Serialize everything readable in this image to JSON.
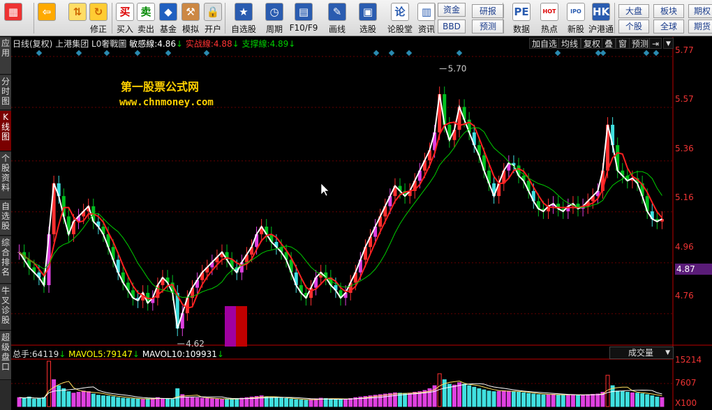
{
  "toolbar": {
    "buttons": [
      {
        "label": "",
        "icon": "grid-icon",
        "glyph": "▦"
      },
      {
        "label": "",
        "icon": "back-arrow-icon",
        "glyph": "⇦"
      },
      {
        "label": "",
        "icon": "up-down-arrow-icon",
        "glyph": "⇅"
      },
      {
        "label": "修正",
        "icon": "refresh-icon",
        "glyph": "↻"
      },
      {
        "label": "买入",
        "icon": "buy-icon",
        "glyph": "买"
      },
      {
        "label": "卖出",
        "icon": "sell-icon",
        "glyph": "卖"
      },
      {
        "label": "基金",
        "icon": "fund-icon",
        "glyph": "◆"
      },
      {
        "label": "模拟",
        "icon": "hammer-icon",
        "glyph": "⚒"
      },
      {
        "label": "开户",
        "icon": "lock-icon",
        "glyph": "🔒"
      },
      {
        "label": "自选股",
        "icon": "star-icon",
        "glyph": "★"
      },
      {
        "label": "周期",
        "icon": "clock-icon",
        "glyph": "◷"
      },
      {
        "label": "F10/F9",
        "icon": "f10-icon",
        "glyph": "▤"
      },
      {
        "label": "画线",
        "icon": "pencil-icon",
        "glyph": "✎"
      },
      {
        "label": "选股",
        "icon": "screen-icon",
        "glyph": "▣"
      },
      {
        "label": "论股堂",
        "icon": "forum-icon",
        "glyph": "论"
      },
      {
        "label": "资讯",
        "icon": "news-icon",
        "glyph": "▥"
      },
      {
        "label": "数据",
        "icon": "pe-icon",
        "glyph": "PE"
      },
      {
        "label": "热点",
        "icon": "hot-icon",
        "glyph": "HOT"
      },
      {
        "label": "新股",
        "icon": "ipo-icon",
        "glyph": "IPO"
      },
      {
        "label": "沪港通",
        "icon": "sse-hkex-icon",
        "glyph": "HK"
      }
    ],
    "small_buttons": {
      "zijin": "资金",
      "bbd": "BBD",
      "yanbao": "研报",
      "yuce": "预测",
      "dapan": "大盘",
      "gegu": "个股",
      "bankuai": "板块",
      "quanqiu": "全球",
      "qihuo1": "期权",
      "qihuo2": "期货"
    }
  },
  "side_tabs": [
    "应用",
    "分时图",
    "K线图",
    "个股资料",
    "自选股",
    "综合排名",
    "牛叉诊股",
    "超级盘口"
  ],
  "header": {
    "period": "日线(复权)",
    "stock": "上港集团",
    "indicator": "L0奢戰圖",
    "s1_label": "敏感線:",
    "s1_value": "4.86",
    "s2_label": "实战線:",
    "s2_value": "4.88",
    "s3_label": "支撑線:",
    "s3_value": "4.89",
    "arrow_down": "↓"
  },
  "controls": [
    "加自选",
    "均线",
    "复权",
    "叠",
    "窗",
    "预测"
  ],
  "watermark": {
    "title": "第一股票公式网",
    "url": "www.chnmoney.com"
  },
  "price_axis": [
    "5.77",
    "5.57",
    "5.36",
    "5.16",
    "4.96",
    "4.76"
  ],
  "current_price": "4.87",
  "annotations": {
    "high": "5.70",
    "low": "4.62"
  },
  "volume_header": {
    "total_label": "总手:",
    "total_value": "64119",
    "mavol5_label": "MAVOL5:",
    "mavol5_value": "79147",
    "mavol10_label": "MAVOL10:",
    "mavol10_value": "109931",
    "arrow_down": "↓",
    "selector": "成交量"
  },
  "volume_axis": [
    "15214",
    "7607",
    "X100"
  ],
  "colors": {
    "up": "#ff3030",
    "down": "#00c020",
    "magenta": "#e040e0",
    "cyan": "#40e0e0",
    "axis": "#e33",
    "white": "#ffffff",
    "green_ma": "#00cc00",
    "red_ma": "#ff2020"
  },
  "chart_data": {
    "type": "candlestick",
    "ylim": [
      4.62,
      5.77
    ],
    "closes": [
      4.98,
      4.95,
      4.92,
      4.9,
      4.88,
      4.85,
      5.05,
      5.25,
      5.2,
      5.12,
      5.05,
      5.1,
      5.12,
      5.14,
      5.16,
      5.1,
      5.08,
      5.05,
      5.0,
      4.95,
      4.9,
      4.86,
      4.83,
      4.8,
      4.79,
      4.82,
      4.78,
      4.8,
      4.85,
      4.88,
      4.86,
      4.82,
      4.68,
      4.74,
      4.8,
      4.84,
      4.87,
      4.9,
      4.92,
      4.94,
      4.96,
      4.98,
      4.95,
      4.92,
      4.9,
      4.94,
      4.97,
      5.0,
      5.05,
      5.08,
      5.05,
      5.02,
      5.0,
      4.98,
      4.95,
      4.9,
      4.85,
      4.82,
      4.8,
      4.84,
      4.88,
      4.9,
      4.88,
      4.85,
      4.83,
      4.8,
      4.82,
      4.86,
      4.9,
      4.95,
      5.0,
      5.04,
      5.08,
      5.12,
      5.16,
      5.2,
      5.24,
      5.22,
      5.2,
      5.22,
      5.26,
      5.3,
      5.34,
      5.38,
      5.45,
      5.6,
      5.48,
      5.42,
      5.46,
      5.55,
      5.5,
      5.45,
      5.4,
      5.36,
      5.3,
      5.25,
      5.2,
      5.25,
      5.3,
      5.33,
      5.32,
      5.28,
      5.26,
      5.22,
      5.18,
      5.15,
      5.14,
      5.16,
      5.17,
      5.15,
      5.14,
      5.16,
      5.17,
      5.15,
      5.16,
      5.18,
      5.2,
      5.22,
      5.3,
      5.48,
      5.4,
      5.3,
      5.28,
      5.26,
      5.27,
      5.25,
      5.2,
      5.14,
      5.11,
      5.1,
      5.11
    ],
    "volumes": [
      3000,
      2800,
      3200,
      2500,
      2600,
      3000,
      15214,
      9000,
      7000,
      6000,
      5000,
      4500,
      4800,
      5200,
      5000,
      4200,
      3800,
      3600,
      3500,
      3300,
      3000,
      2800,
      2700,
      2600,
      2500,
      2400,
      2600,
      2800,
      3000,
      2700,
      2500,
      2400,
      6000,
      4000,
      3200,
      3000,
      2900,
      2800,
      2700,
      2600,
      2500,
      2400,
      2500,
      2600,
      2700,
      2800,
      3000,
      3200,
      3400,
      3600,
      3300,
      3100,
      2900,
      2800,
      2700,
      2500,
      2300,
      2200,
      2100,
      2400,
      2600,
      2800,
      2700,
      2600,
      2500,
      2400,
      2500,
      2700,
      3000,
      3200,
      3400,
      3600,
      3800,
      4000,
      4200,
      4400,
      4600,
      4500,
      4400,
      4500,
      4800,
      5000,
      5400,
      6000,
      7000,
      11000,
      9000,
      7500,
      7200,
      8000,
      7500,
      7000,
      6500,
      6000,
      5600,
      5200,
      5000,
      5100,
      5300,
      5200,
      5000,
      4800,
      4600,
      4400,
      4200,
      4000,
      3900,
      4000,
      4100,
      3900,
      3800,
      3900,
      4000,
      3800,
      3900,
      4000,
      4100,
      4200,
      4800,
      10500,
      7000,
      5200,
      5000,
      4800,
      4600,
      4500,
      4300,
      4000,
      3600,
      3200,
      3000
    ]
  }
}
